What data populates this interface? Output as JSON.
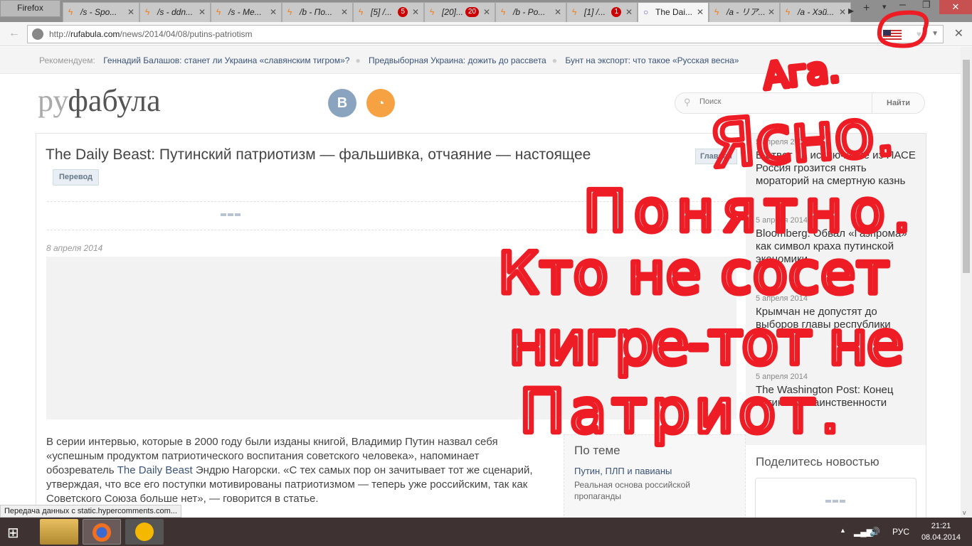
{
  "browser": {
    "menu": "Firefox",
    "tabs": [
      {
        "label": "/s - Spo...",
        "badge": null
      },
      {
        "label": "/s - ddn...",
        "badge": null
      },
      {
        "label": "/s - Me...",
        "badge": null
      },
      {
        "label": "/b - По...",
        "badge": null
      },
      {
        "label": "[5] /...",
        "badge": "5"
      },
      {
        "label": "[20]...",
        "badge": "20"
      },
      {
        "label": "/b - Po...",
        "badge": null
      },
      {
        "label": "[1] /...",
        "badge": "1"
      },
      {
        "label": "The Dai...",
        "badge": null
      },
      {
        "label": "/a - リア...",
        "badge": null
      },
      {
        "label": "/a - Хэй...",
        "badge": null
      }
    ],
    "url_prefix": "http://",
    "url_host": "rufabula.com",
    "url_path": "/news/2014/04/08/putins-patriotism",
    "status": "Передача данных с static.hypercomments.com..."
  },
  "recommend": {
    "label": "Рекомендуем:",
    "links": [
      "Геннадий Балашов: станет ли Украина «славянским тигром»?",
      "Предвыборная Украина: дожить до рассвета",
      "Бунт на экспорт: что такое «Русская весна»"
    ]
  },
  "header": {
    "logo_a": "ру",
    "logo_b": "фабула",
    "vk": "В",
    "search_placeholder": "Поиск",
    "search_button": "Найти"
  },
  "article": {
    "title": "The Daily Beast: Путинский патриотизм — фальшивка, отчаяние — настоящее",
    "section": "Главная",
    "tag": "Перевод",
    "date": "8 апреля 2014",
    "body_1": "В серии интервью, которые в 2000 году были изданы книгой, Владимир Путин назвал себя «успешным продуктом патриотического воспитания советского человека», напоминает обозреватель ",
    "body_link": "The Daily Beast",
    "body_2": " Эндрю Нагорски. «С тех самых пор он зачитывает тот же сценарий, утверждая, что все его поступки мотивированы патриотизмом — теперь уже российским, так как Советского Союза больше нет», — говорится в статье."
  },
  "related": {
    "title": "По теме",
    "link_1": "Путин",
    "link_2": "ПЛП",
    "link_rest": " и павианы",
    "desc": "Реальная основа российской пропаганды"
  },
  "sidebar": {
    "news": [
      {
        "date": "5 апреля 2014",
        "title": "В ответ на исключение из ПАСЕ Россия грозится снять мораторий на смертную казнь"
      },
      {
        "date": "5 апреля 2014",
        "title": "Bloomberg: Обвал «Газпрома» как символ краха путинской экономики"
      },
      {
        "date": "5 апреля 2014",
        "title": "Крымчан не допустят до выборов главы республики"
      },
      {
        "date": "5 апреля 2014",
        "title": "The Washington Post: Конец путинской таинственности"
      }
    ],
    "share_title": "Поделитесь новостью"
  },
  "taskbar": {
    "lang": "РУС",
    "time": "21:21",
    "date": "08.04.2014"
  },
  "annotation": {
    "lines": [
      "Ага.",
      "Ясно.",
      "Понятно.",
      "Кто не сосет",
      "нигре-тот не",
      "Патриот."
    ],
    "color": "#ee1c24"
  }
}
